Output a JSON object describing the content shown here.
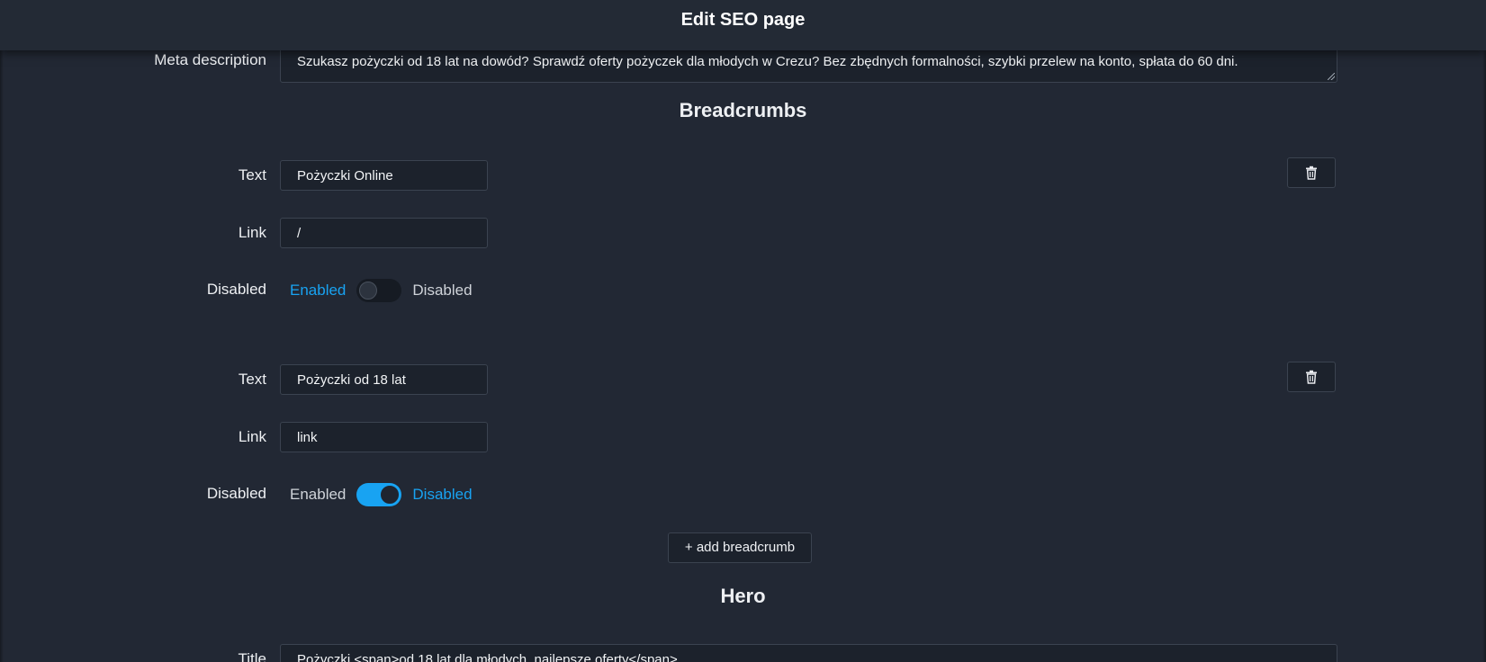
{
  "header": {
    "title": "Edit SEO page"
  },
  "meta_description": {
    "label": "Meta description",
    "value": "Szukasz pożyczki od 18 lat na dowód? Sprawdź oferty pożyczek dla młodych w Crezu? Bez zbędnych formalności, szybki przelew na konto, spłata do 60 dni."
  },
  "breadcrumbs": {
    "title": "Breadcrumbs",
    "items": [
      {
        "text_label": "Text",
        "text_value": "Pożyczki Online",
        "link_label": "Link",
        "link_value": "/",
        "disabled_label": "Disabled",
        "enabled_option": "Enabled",
        "disabled_option": "Disabled",
        "is_disabled": false
      },
      {
        "text_label": "Text",
        "text_value": "Pożyczki od 18 lat",
        "link_label": "Link",
        "link_value": "link",
        "disabled_label": "Disabled",
        "enabled_option": "Enabled",
        "disabled_option": "Disabled",
        "is_disabled": true
      }
    ],
    "add_label": "+ add breadcrumb"
  },
  "hero": {
    "title": "Hero",
    "title_label": "Title",
    "title_value": "Pożyczki <span>od 18 lat dla młodych, najlepsze oferty</span>"
  },
  "icons": {
    "delete": "trash-icon",
    "resize": "resize-grip-icon"
  },
  "colors": {
    "accent": "#18a3f2",
    "background": "#222834",
    "input_bg": "#1c222c",
    "header_bg": "#232a35"
  }
}
